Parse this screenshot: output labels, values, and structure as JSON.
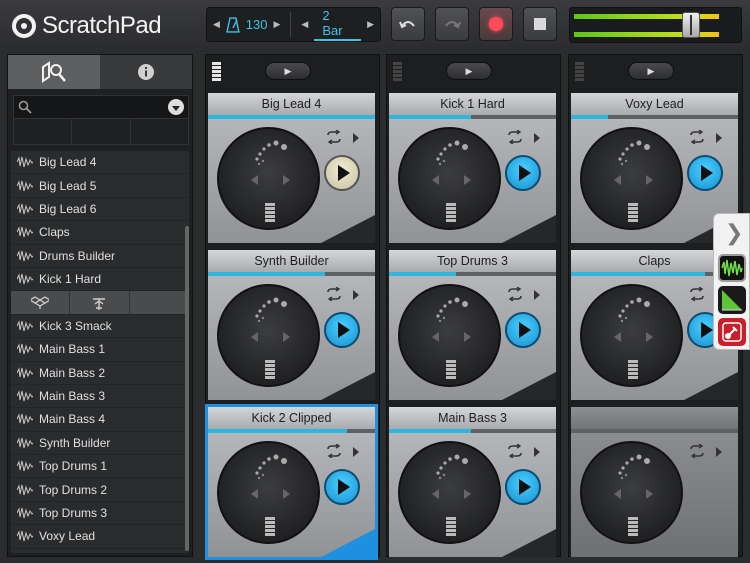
{
  "app": {
    "title": "ScratchPad"
  },
  "transport": {
    "tempo": "130",
    "bar_length": "2 Bar"
  },
  "colors": {
    "accent": "#2fb6e0",
    "record": "#ff4a5a",
    "selection": "#1f8fe0"
  },
  "browser": {
    "tabs": [
      {
        "icon": "search-browse-icon",
        "active": true
      },
      {
        "icon": "info-icon",
        "active": false
      }
    ],
    "search": {
      "placeholder": "",
      "value": ""
    },
    "items": [
      "Big Lead 4",
      "Big Lead 5",
      "Big Lead 6",
      "Claps",
      "Drums Builder",
      "Kick 1 Hard",
      "Kick 3 Smack",
      "Main Bass 1",
      "Main Bass 2",
      "Main Bass 3",
      "Main Bass 4",
      "Synth Builder",
      "Top Drums 1",
      "Top Drums 2",
      "Top Drums 3",
      "Voxy Lead"
    ],
    "cloud_row": [
      "dropbox-icon",
      "soundcloud-icon",
      ""
    ]
  },
  "columns": [
    {
      "meter_on": true,
      "slots": [
        {
          "name": "Big Lead 4",
          "progress": 1.0,
          "state": "pending"
        },
        {
          "name": "Synth Builder",
          "progress": 0.7,
          "state": "ready"
        },
        {
          "name": "Kick 2 Clipped",
          "progress": 0.83,
          "state": "ready",
          "selected": true
        }
      ]
    },
    {
      "meter_on": false,
      "slots": [
        {
          "name": "Kick 1 Hard",
          "progress": 0.49,
          "state": "ready"
        },
        {
          "name": "Top Drums 3",
          "progress": 0.4,
          "state": "ready"
        },
        {
          "name": "Main Bass 3",
          "progress": 0.49,
          "state": "ready"
        }
      ]
    },
    {
      "meter_on": false,
      "slots": [
        {
          "name": "Voxy Lead",
          "progress": 0.22,
          "state": "ready"
        },
        {
          "name": "Claps",
          "progress": 0.8,
          "state": "ready"
        },
        {
          "name": "",
          "progress": 0,
          "state": "empty"
        }
      ]
    }
  ],
  "drawer": {
    "apps": [
      "waveform-app-icon",
      "studio-app-icon",
      "guitar-app-icon"
    ]
  }
}
